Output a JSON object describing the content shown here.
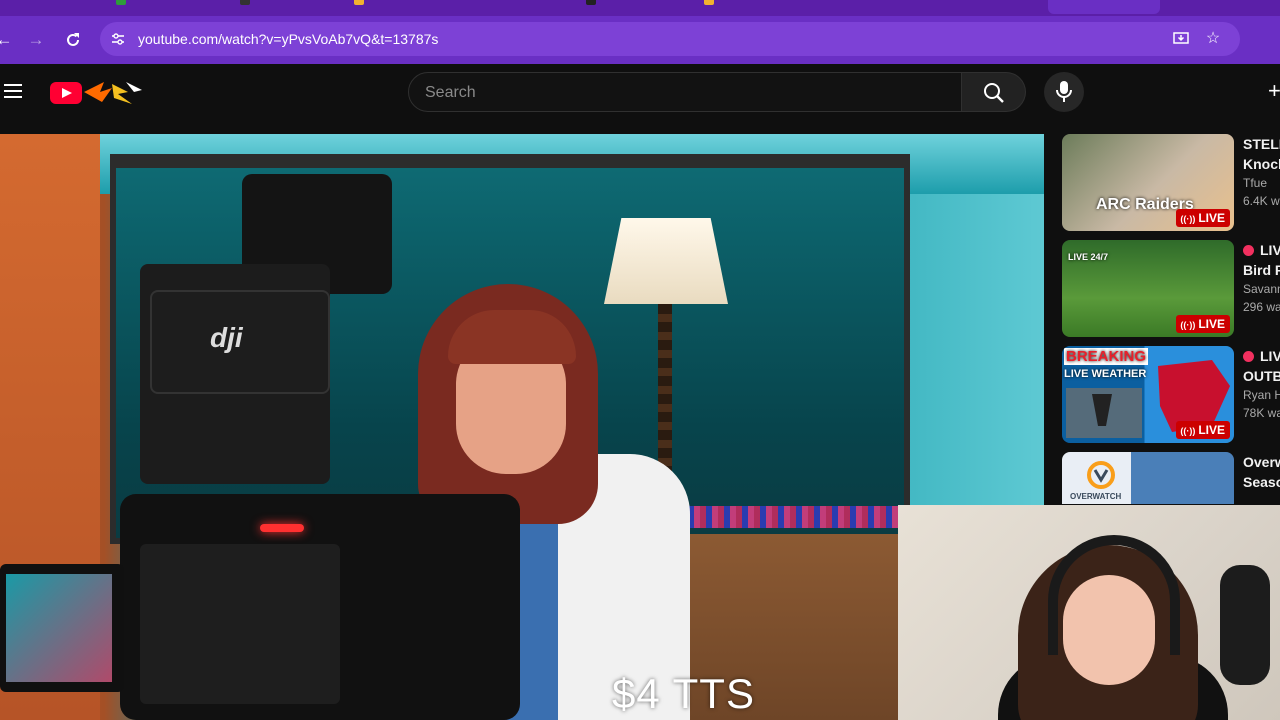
{
  "browser": {
    "url": "youtube.com/watch?v=yPvsVoAb7vQ&t=13787s",
    "back_icon": "arrow-left-icon",
    "forward_icon": "arrow-right-icon",
    "reload_icon": "reload-icon",
    "install_icon": "install-app-icon",
    "bookmark_icon": "star-icon"
  },
  "youtube": {
    "search_placeholder": "Search",
    "menu_icon": "hamburger-menu-icon",
    "search_icon": "search-icon",
    "mic_icon": "microphone-icon"
  },
  "video": {
    "overlay_text": "$4 TTS"
  },
  "related": [
    {
      "title": "STELL",
      "title2": "Knock",
      "channel": "Tfue",
      "views": "6.4K w",
      "badge": "LIVE",
      "thumb_text": "ARC Raiders",
      "live_dot": false
    },
    {
      "title": "LIV",
      "title2": "Bird F",
      "channel": "Savann",
      "views": "296 wa",
      "badge": "LIVE",
      "thumb_text": "LIVE 24/7",
      "live_dot": true
    },
    {
      "title": "LIV",
      "title2": "OUTB",
      "channel": "Ryan H",
      "views": "78K wa",
      "badge": "LIVE",
      "thumb_text": "BREAKING",
      "thumb_text2": "LIVE WEATHER",
      "live_dot": true
    },
    {
      "title": "Overw",
      "title2": "Seaso",
      "channel": "",
      "views": "",
      "badge": "",
      "thumb_text": "OVERWATCH",
      "live_dot": false
    }
  ]
}
